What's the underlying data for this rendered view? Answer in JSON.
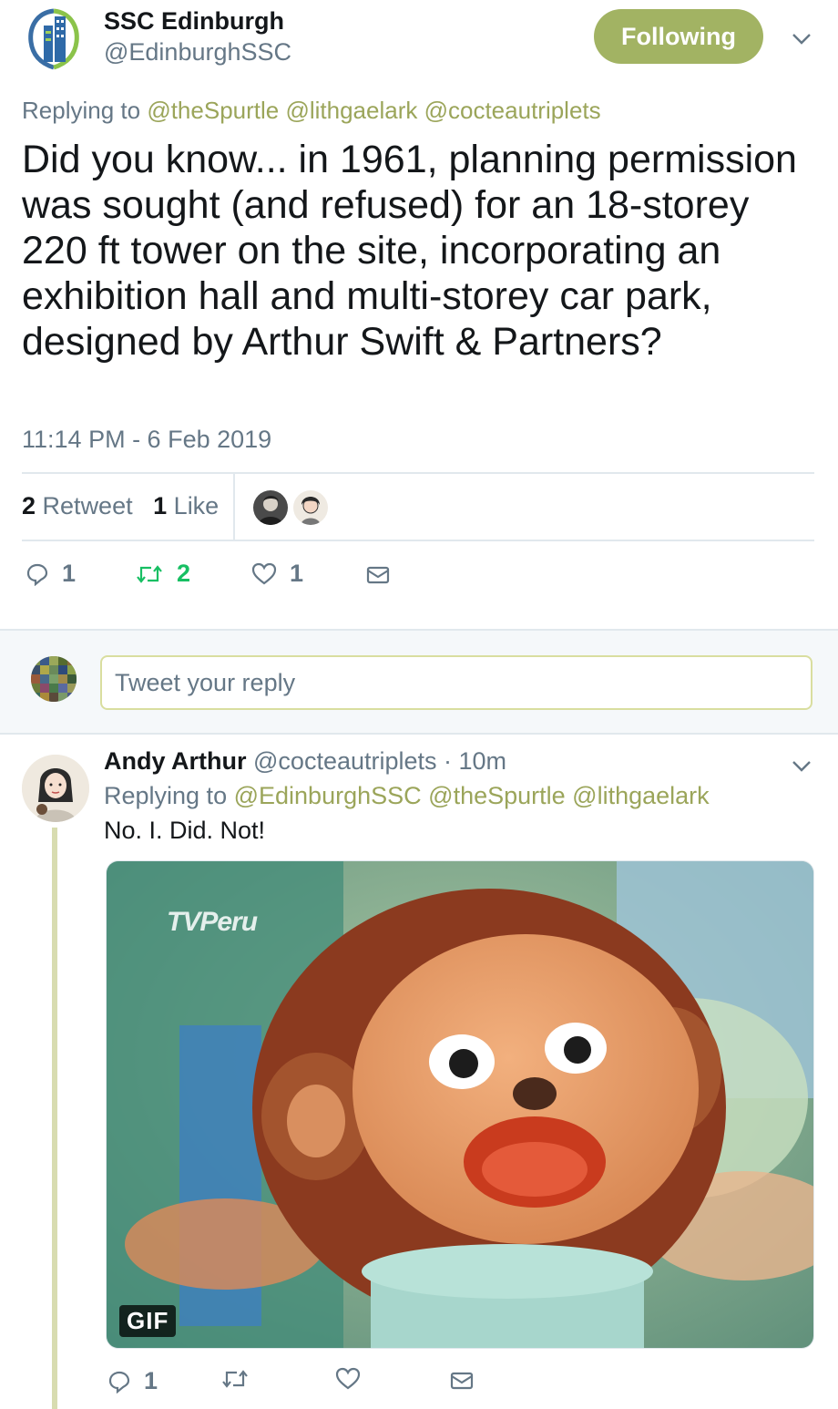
{
  "tweet": {
    "author_name": "SSC Edinburgh",
    "author_handle": "@EdinburghSSC",
    "follow_label": "Following",
    "replying_prefix": "Replying to",
    "replying_mentions": [
      "@theSpurtle",
      "@lithgaelark",
      "@cocteautriplets"
    ],
    "text": "Did you know... in 1961, planning permission was sought (and refused) for an 18-storey 220 ft tower on the site, incorporating an exhibition hall and multi-storey car park, designed by Arthur Swift & Partners?",
    "timestamp": "11:14 PM - 6 Feb 2019",
    "retweet_count": "2",
    "retweet_label": "Retweet",
    "like_count": "1",
    "like_label": "Like",
    "actions": {
      "reply_count": "1",
      "retweet_count": "2",
      "like_count": "1"
    }
  },
  "composer": {
    "placeholder": "Tweet your reply"
  },
  "reply": {
    "author_name": "Andy Arthur",
    "author_handle": "@cocteautriplets",
    "age": "· 10m",
    "replying_prefix": "Replying to",
    "replying_mentions": [
      "@EdinburghSSC",
      "@theSpurtle",
      "@lithgaelark"
    ],
    "text": "No. I. Did. Not!",
    "media_badge": "GIF",
    "media_watermark": "TVPeru",
    "actions": {
      "reply_count": "1"
    }
  },
  "colors": {
    "accent_green": "#a2b363",
    "mention": "#9ba55a",
    "retweet_active": "#17bf63",
    "muted": "#657786"
  },
  "icons": [
    "building-logo-icon",
    "chevron-down-icon",
    "reply-icon",
    "retweet-icon",
    "heart-icon",
    "envelope-icon"
  ]
}
